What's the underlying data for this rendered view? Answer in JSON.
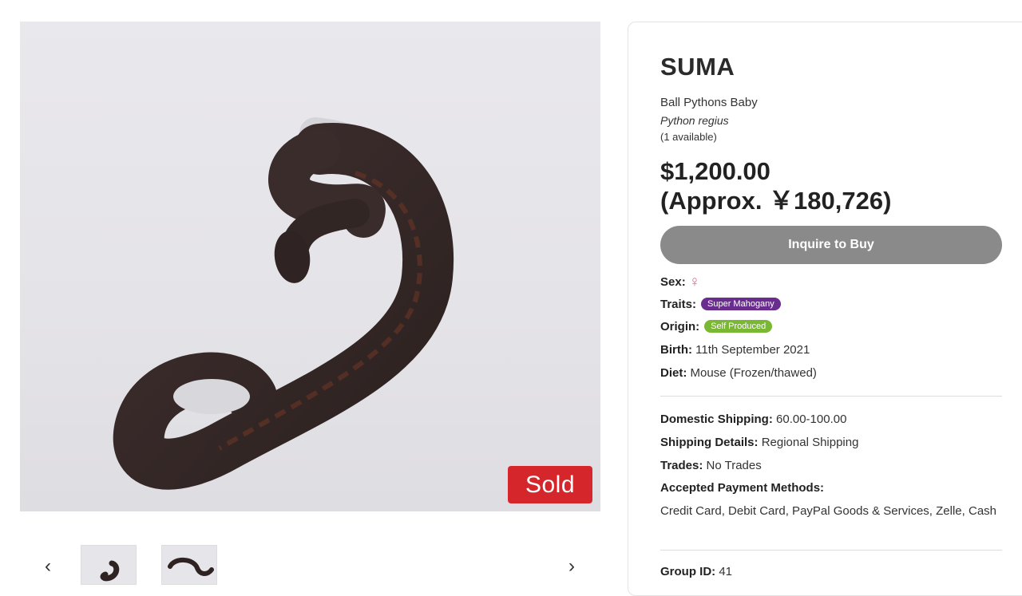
{
  "gallery": {
    "sold_label": "Sold",
    "prev_icon": "chevron-left-icon",
    "next_icon": "chevron-right-icon",
    "thumbnails": 2
  },
  "listing": {
    "title": "SUMA",
    "category": "Ball Pythons Baby",
    "species": "Python regius",
    "availability": "(1 available)",
    "price": "$1,200.00",
    "price_approx": "(Approx. ￥180,726)",
    "inquire_label": "Inquire to Buy",
    "sex_label": "Sex:",
    "sex_icon": "female-icon",
    "traits_label": "Traits:",
    "trait": "Super Mahogany",
    "trait_color": "#6a2d8f",
    "origin_label": "Origin:",
    "origin": "Self Produced",
    "origin_color": "#7ab733",
    "birth_label": "Birth:",
    "birth": "11th September 2021",
    "diet_label": "Diet:",
    "diet": "Mouse (Frozen/thawed)",
    "shipping_label": "Domestic Shipping:",
    "shipping": "60.00-100.00",
    "shipping_details_label": "Shipping Details:",
    "shipping_details": "Regional Shipping",
    "trades_label": "Trades:",
    "trades": "No Trades",
    "payment_label": "Accepted Payment Methods:",
    "payment": "Credit Card, Debit Card, PayPal Goods & Services, Zelle, Cash",
    "group_label": "Group ID:",
    "group_id": "41"
  }
}
